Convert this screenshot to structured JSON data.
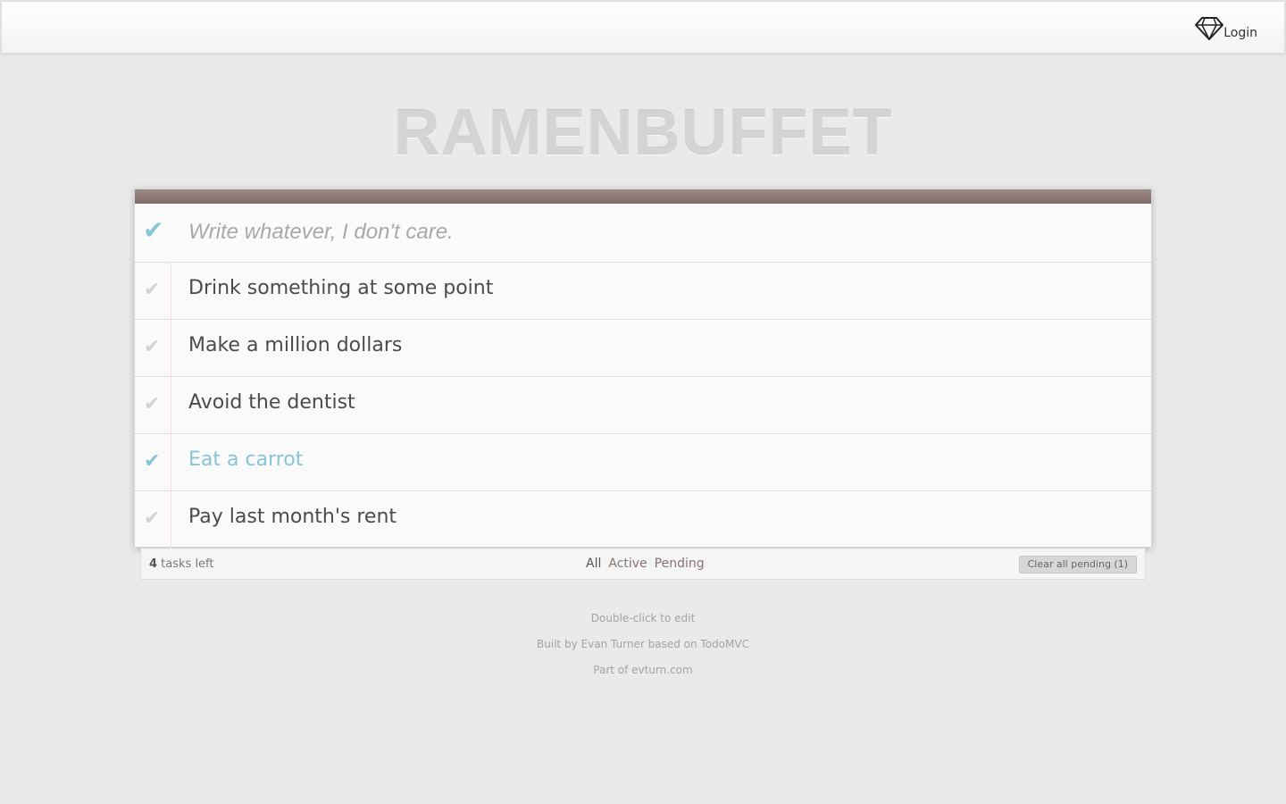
{
  "topbar": {
    "login_icon": "diamond-icon",
    "login_label": "Login"
  },
  "app": {
    "title": "RAMENBUFFET"
  },
  "new_todo": {
    "placeholder": "Write whatever, I don't care.",
    "toggle_all_icon": "checkmark-icon"
  },
  "tasks": [
    {
      "label": "Drink something at some point",
      "completed": false
    },
    {
      "label": "Make a million dollars",
      "completed": false
    },
    {
      "label": "Avoid the dentist",
      "completed": false
    },
    {
      "label": "Eat a carrot",
      "completed": true
    },
    {
      "label": "Pay last month's rent",
      "completed": false
    }
  ],
  "footer": {
    "count_number": "4",
    "count_suffix": " tasks left",
    "filters": [
      "All",
      "Active",
      "Pending"
    ],
    "selected_filter": "All",
    "clear_label": "Clear all pending (1)"
  },
  "info": {
    "line1": "Double-click to edit",
    "line2": "Built by Evan Turner based on TodoMVC",
    "line3": "Part of evturn.com"
  },
  "colors": {
    "accent": "#86c5d7",
    "header_bar": "#8b7a76",
    "background": "#eaeaea"
  }
}
